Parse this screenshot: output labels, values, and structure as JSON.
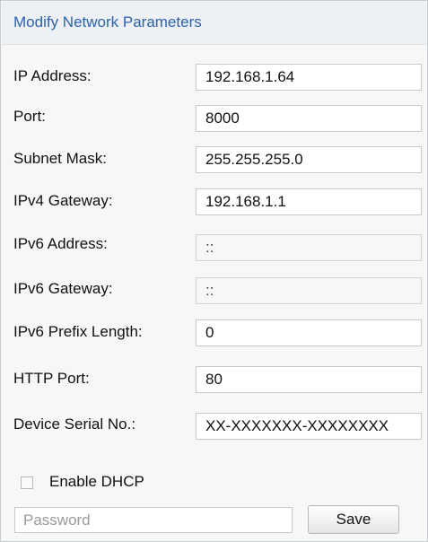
{
  "header": {
    "title": "Modify Network Parameters"
  },
  "fields": {
    "ip_address": {
      "label": "IP Address:",
      "value": "192.168.1.64"
    },
    "port": {
      "label": "Port:",
      "value": "8000"
    },
    "subnet_mask": {
      "label": "Subnet Mask:",
      "value": "255.255.255.0"
    },
    "ipv4_gateway": {
      "label": "IPv4 Gateway:",
      "value": "192.168.1.1"
    },
    "ipv6_address": {
      "label": "IPv6 Address:",
      "value": "::"
    },
    "ipv6_gateway": {
      "label": "IPv6 Gateway:",
      "value": "::"
    },
    "ipv6_prefix_length": {
      "label": "IPv6 Prefix Length:",
      "value": "0"
    },
    "http_port": {
      "label": "HTTP Port:",
      "value": "80"
    },
    "device_serial": {
      "label": "Device Serial No.:",
      "value": "XX-XXXXXXX-XXXXXXXX"
    }
  },
  "dhcp": {
    "label": "Enable DHCP",
    "checked": false
  },
  "password": {
    "placeholder": "Password",
    "value": ""
  },
  "save_label": "Save"
}
